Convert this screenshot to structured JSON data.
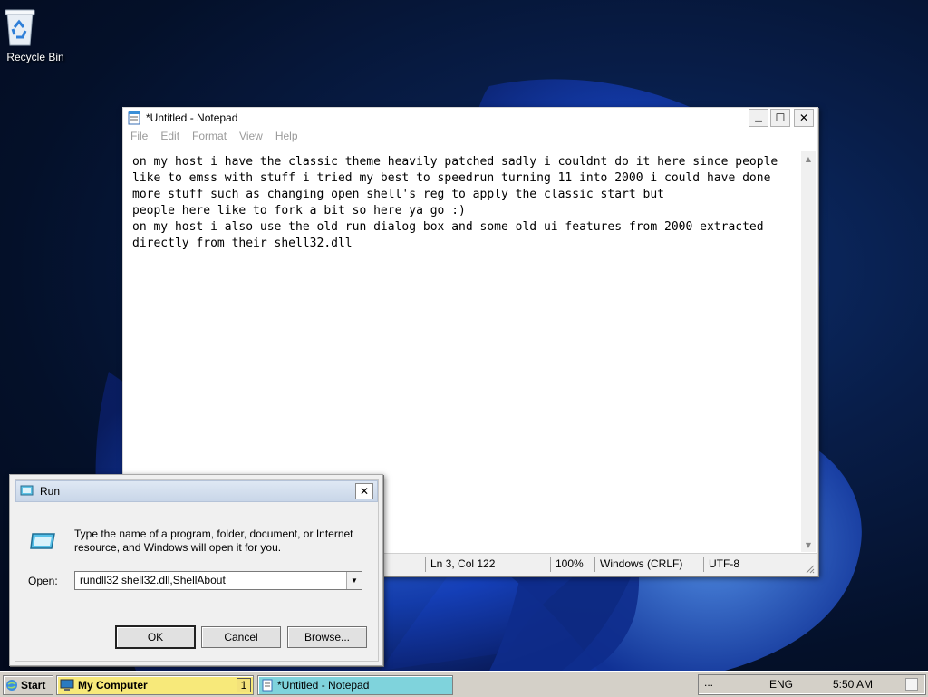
{
  "desktop": {
    "icons": [
      {
        "label": "Recycle Bin",
        "icon": "recycle-bin-icon"
      }
    ]
  },
  "notepad": {
    "title": "*Untitled - Notepad",
    "menu": [
      "File",
      "Edit",
      "Format",
      "View",
      "Help"
    ],
    "content": "on my host i have the classic theme heavily patched sadly i couldnt do it here since people\nlike to emss with stuff i tried my best to speedrun turning 11 into 2000 i could have done\nmore stuff such as changing open shell's reg to apply the classic start but\npeople here like to fork a bit so here ya go :)\non my host i also use the old run dialog box and some old ui features from 2000 extracted\ndirectly from their shell32.dll",
    "status": {
      "position": "Ln 3, Col 122",
      "zoom": "100%",
      "line_ending": "Windows (CRLF)",
      "encoding": "UTF-8"
    },
    "controls": {
      "minimize": "▁",
      "maximize": "☐",
      "close": "✕"
    }
  },
  "run_dialog": {
    "title": "Run",
    "description": "Type the name of a program, folder, document, or Internet resource, and Windows will open it for you.",
    "open_label": "Open:",
    "open_value": "rundll32 shell32.dll,ShellAbout",
    "ok_label": "OK",
    "cancel_label": "Cancel",
    "browse_label": "Browse...",
    "close": "✕"
  },
  "taskbar": {
    "start_label": "Start",
    "items": [
      {
        "label": "My Computer",
        "badge": "1",
        "active": true,
        "color": "#f7e97a"
      },
      {
        "label": "*Untitled - Notepad",
        "active": false,
        "color": "#7fd3dc"
      }
    ],
    "tray": {
      "chevron": "...",
      "language": "ENG",
      "time": "5:50 AM"
    }
  },
  "colors": {
    "desktop_accent": "#1f5fe0",
    "run_title": "#c9d6e8"
  }
}
